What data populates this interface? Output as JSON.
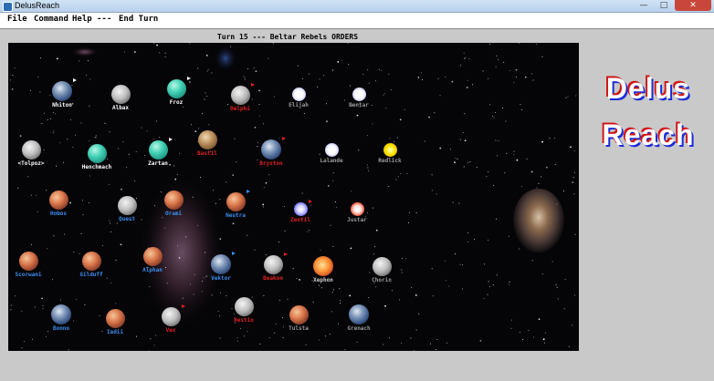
{
  "window": {
    "title": "DelusReach",
    "min": "—",
    "max": "□",
    "close": "✕"
  },
  "menu": {
    "file": "File",
    "command": "Command",
    "help": "Help",
    "sep": "---",
    "end_turn": "End Turn"
  },
  "turn_label": "Turn 15 --- Beltar Rebels ORDERS",
  "logo": {
    "line1": "Delus",
    "line2": "Reach"
  },
  "planets": [
    {
      "name": "Nhiton",
      "kind": "earth",
      "label_color": "#ffffff",
      "flag": "#ffffff"
    },
    {
      "name": "Albax",
      "kind": "moon",
      "label_color": "#ffffff",
      "flag": ""
    },
    {
      "name": "Froz",
      "kind": "teal",
      "label_color": "#ffffff",
      "flag": "#ffffff"
    },
    {
      "name": "Delphi",
      "kind": "moon",
      "label_color": "#e02020",
      "flag": "#e02020"
    },
    {
      "name": "Elijah",
      "kind": "whitestar",
      "label_color": "#9a9a9a",
      "flag": ""
    },
    {
      "name": "Bentar",
      "kind": "whitestar",
      "label_color": "#9a9a9a",
      "flag": ""
    },
    {
      "name": "<Tolpoz>",
      "kind": "moon",
      "label_color": "#ffffff",
      "flag": ""
    },
    {
      "name": "Henchmach",
      "kind": "teal",
      "label_color": "#ffffff",
      "flag": ""
    },
    {
      "name": "Zartan",
      "kind": "teal",
      "label_color": "#ffffff",
      "flag": "#ffffff"
    },
    {
      "name": "Bastil",
      "kind": "brown",
      "label_color": "#e02020",
      "flag": ""
    },
    {
      "name": "Bryston",
      "kind": "earth",
      "label_color": "#e02020",
      "flag": "#e02020"
    },
    {
      "name": "Lalande",
      "kind": "whitestar",
      "label_color": "#9a9a9a",
      "flag": ""
    },
    {
      "name": "Redlick",
      "kind": "yellowstar",
      "label_color": "#9a9a9a",
      "flag": ""
    },
    {
      "name": "Hobos",
      "kind": "mars",
      "label_color": "#3a8ef0",
      "flag": ""
    },
    {
      "name": "Quest",
      "kind": "moon",
      "label_color": "#3a8ef0",
      "flag": ""
    },
    {
      "name": "Orami",
      "kind": "mars",
      "label_color": "#3a8ef0",
      "flag": ""
    },
    {
      "name": "Neutra",
      "kind": "mars",
      "label_color": "#3a8ef0",
      "flag": "#3a8ef0"
    },
    {
      "name": "Zentil",
      "kind": "bluestar",
      "label_color": "#e02020",
      "flag": "#e02020"
    },
    {
      "name": "Justar",
      "kind": "redwhite",
      "label_color": "#9a9a9a",
      "flag": ""
    },
    {
      "name": "Scorwani",
      "kind": "mars",
      "label_color": "#3a8ef0",
      "flag": ""
    },
    {
      "name": "Gilduff",
      "kind": "mars",
      "label_color": "#3a8ef0",
      "flag": ""
    },
    {
      "name": "Alphan",
      "kind": "mars",
      "label_color": "#3a8ef0",
      "flag": ""
    },
    {
      "name": "Vektor",
      "kind": "earth",
      "label_color": "#3a8ef0",
      "flag": "#3a8ef0"
    },
    {
      "name": "Beakon",
      "kind": "moon",
      "label_color": "#e02020",
      "flag": "#e02020"
    },
    {
      "name": "Xephon",
      "kind": "orangestar",
      "label_color": "#cfcfcf",
      "flag": ""
    },
    {
      "name": "Chorin",
      "kind": "moon",
      "label_color": "#9a9a9a",
      "flag": ""
    },
    {
      "name": "Bonno",
      "kind": "earth",
      "label_color": "#3a8ef0",
      "flag": ""
    },
    {
      "name": "Indii",
      "kind": "mars",
      "label_color": "#3a8ef0",
      "flag": ""
    },
    {
      "name": "Vex",
      "kind": "moon",
      "label_color": "#e02020",
      "flag": "#e02020"
    },
    {
      "name": "Restin",
      "kind": "moon",
      "label_color": "#e02020",
      "flag": ""
    },
    {
      "name": "Tulsta",
      "kind": "mars",
      "label_color": "#9a9a9a",
      "flag": ""
    },
    {
      "name": "Grenach",
      "kind": "earth",
      "label_color": "#9a9a9a",
      "flag": ""
    }
  ],
  "colors": {
    "rebel_red": "#e02020",
    "ally_blue": "#3a8ef0",
    "neutral_grey": "#9a9a9a",
    "player_white": "#ffffff"
  }
}
